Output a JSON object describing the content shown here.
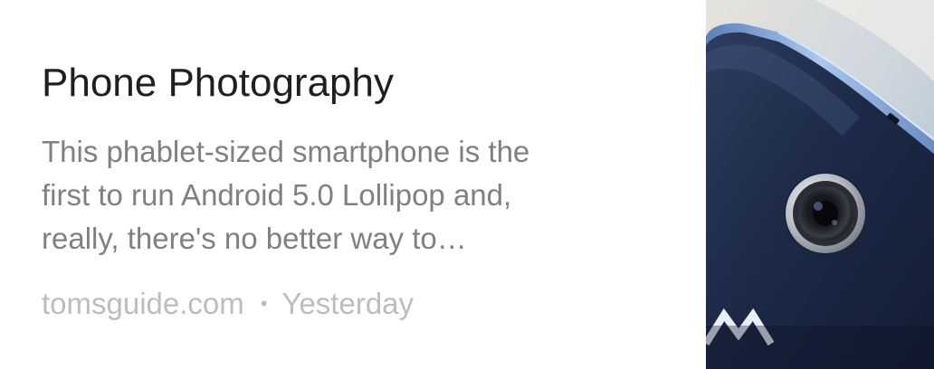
{
  "card": {
    "title": "Phone Photography",
    "snippet_lines": [
      "This phablet-sized smartphone is the",
      "first to run Android 5.0 Lollipop and,",
      "really, there's no better way to…"
    ],
    "source": "tomsguide.com",
    "separator": "•",
    "time": "Yesterday",
    "thumbnail_subject": "phone-camera-photo"
  },
  "colors": {
    "title": "#1f1f1f",
    "snippet": "#808080",
    "meta": "#bdbdbd",
    "phone_body": "#1c2a4a",
    "phone_frame": "#8fb4e8"
  }
}
